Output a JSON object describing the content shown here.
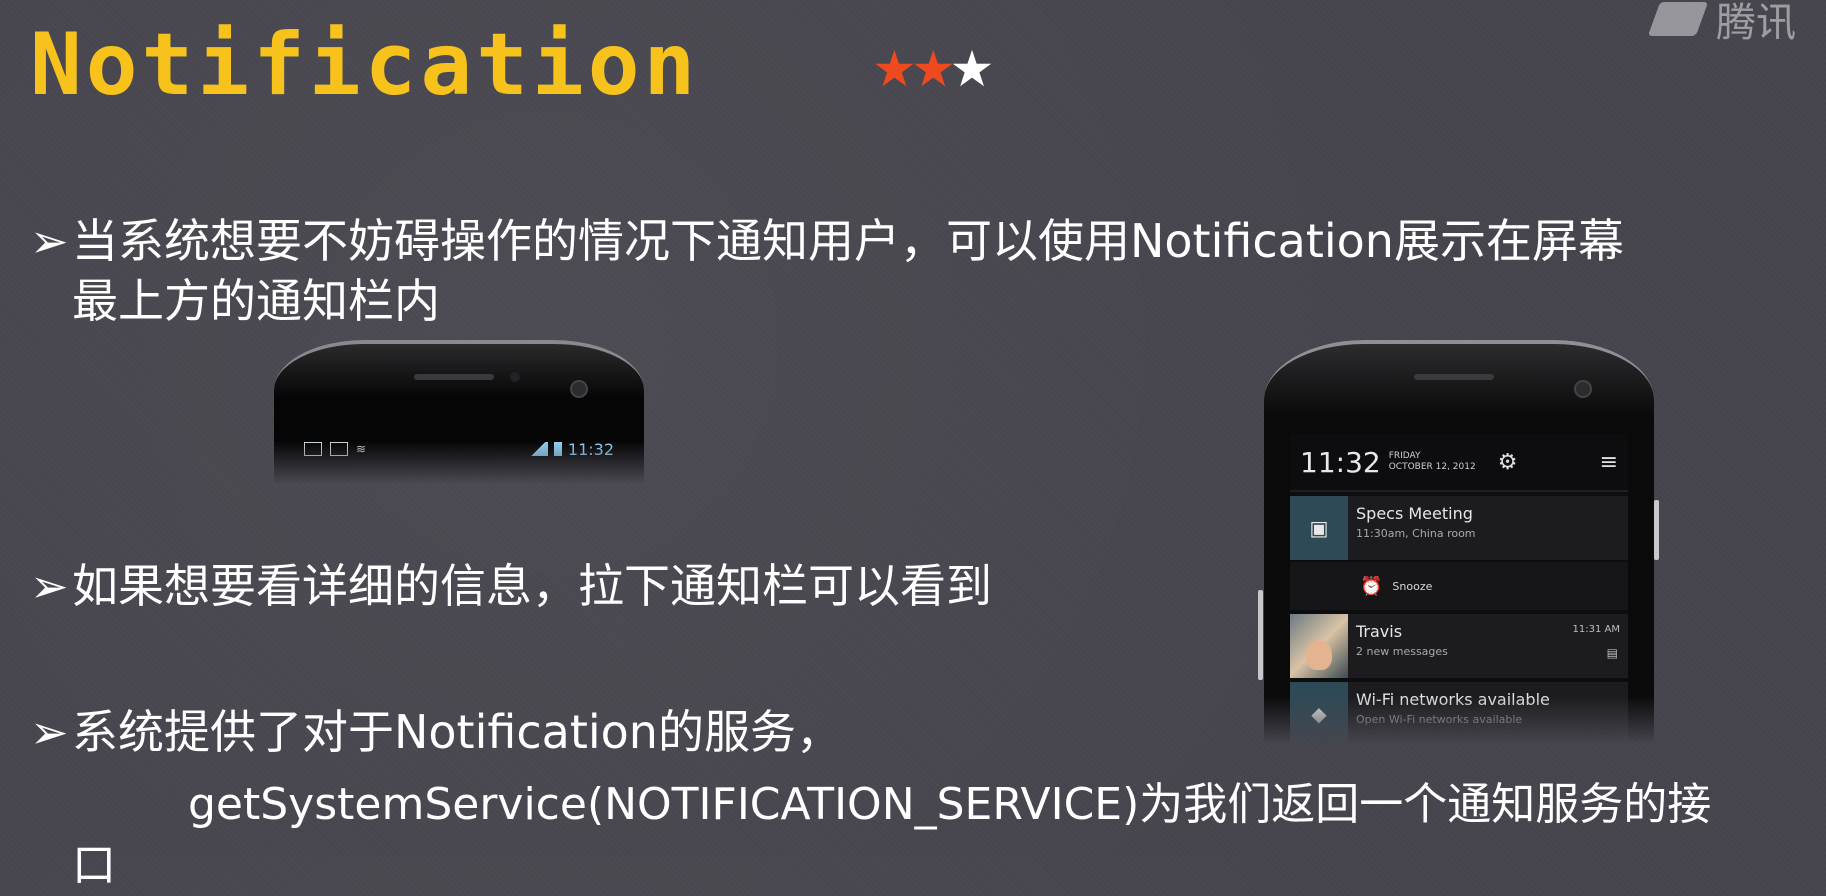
{
  "slide": {
    "title": "Notification",
    "rating": {
      "filled": 2,
      "total": 3,
      "filled_color": "#ef4a1e",
      "empty_color": "#ffffff"
    },
    "watermark": "腾讯"
  },
  "bullets": {
    "marker": "➢",
    "b1_line1": "当系统想要不妨碍操作的情况下通知用户，可以使用Notification展示在屏幕",
    "b1_line2": "最上方的通知栏内",
    "b2": "如果想要看详细的信息，拉下通知栏可以看到",
    "b3_line1": "系统提供了对于Notification的服务，",
    "b3_line2": "getSystemService(NOTIFICATION_SERVICE)为我们返回一个通知服务的接",
    "b3_line3": "口"
  },
  "phone_small": {
    "time": "11:32",
    "status_icons": [
      "calendar-icon",
      "chat-icon",
      "wifi-icon"
    ]
  },
  "phone_big": {
    "time": "11:32",
    "day": "FRIDAY",
    "date": "OCTOBER 12, 2012",
    "notifications": [
      {
        "title": "Specs Meeting",
        "subtitle": "11:30am, China room",
        "icon": "calendar-icon"
      },
      {
        "title": "Travis",
        "subtitle": "2 new messages",
        "time": "11:31 AM",
        "icon": "avatar"
      },
      {
        "title": "Wi-Fi networks available",
        "subtitle": "Open Wi-Fi networks available",
        "icon": "wifi-icon"
      }
    ],
    "snooze_label": "Snooze"
  }
}
